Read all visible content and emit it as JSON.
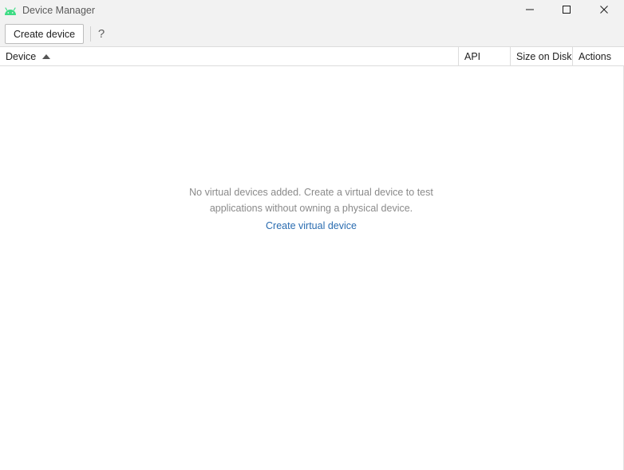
{
  "window": {
    "title": "Device Manager",
    "icon": "android-icon",
    "controls": [
      "minimize-icon",
      "maximize-icon",
      "close-icon"
    ]
  },
  "toolbar": {
    "create_label": "Create device",
    "help_label": "?"
  },
  "table": {
    "columns": [
      "Device",
      "API",
      "Size on Disk",
      "Actions"
    ],
    "sort_column": "Device",
    "sort_direction": "ascending"
  },
  "empty_state": {
    "line1": "No virtual devices added. Create a virtual device to test",
    "line2": "applications without owning a physical device.",
    "link_label": "Create virtual device"
  },
  "colors": {
    "android_green": "#3ddc84",
    "link": "#2a6cb0",
    "muted_text": "#8a8a8a"
  }
}
